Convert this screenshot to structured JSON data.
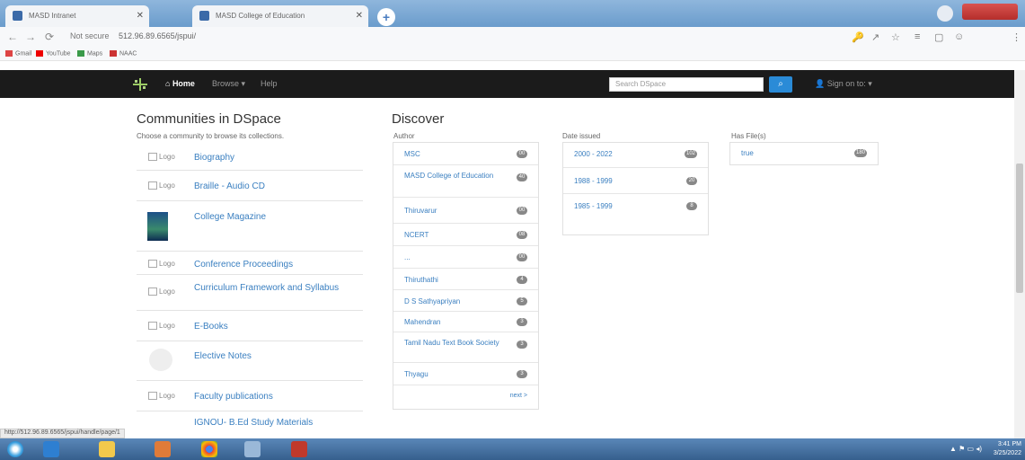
{
  "browser": {
    "tabs": [
      {
        "title": "MASD Intranet"
      },
      {
        "title": "MASD College of Education"
      }
    ],
    "address": {
      "warning": "Not secure",
      "url": "512.96.89.6565/jspui/"
    },
    "bookmarks": [
      "Gmail",
      "YouTube",
      "Maps",
      "NAAC"
    ]
  },
  "site_nav": {
    "home": "Home",
    "browse": "Browse ▾",
    "help": "Help",
    "search_placeholder": "Search DSpace",
    "login": "Sign on to: ▾"
  },
  "communities": {
    "title": "Communities in DSpace",
    "subtitle": "Choose a community to browse its collections.",
    "logo_alt": "Logo",
    "items": [
      {
        "label": "Biography"
      },
      {
        "label": "Braille - Audio CD"
      },
      {
        "label": "College Magazine"
      },
      {
        "label": "Conference Proceedings"
      },
      {
        "label": "Curriculum Framework and Syllabus"
      },
      {
        "label": "E-Books"
      },
      {
        "label": "Elective Notes"
      },
      {
        "label": "Faculty publications"
      },
      {
        "label": "IGNOU- B.Ed Study Materials"
      }
    ]
  },
  "discover": {
    "title": "Discover",
    "author": {
      "label": "Author",
      "items": [
        {
          "name": "MSC",
          "count": "00"
        },
        {
          "name": "MASD College of Education",
          "count": "40"
        },
        {
          "name": "Thiruvarur",
          "count": "00"
        },
        {
          "name": "NCERT",
          "count": "08"
        },
        {
          "name": "...",
          "count": "00"
        },
        {
          "name": "Thiruthathi",
          "count": "4"
        },
        {
          "name": "D S Sathyapriyan",
          "count": "5"
        },
        {
          "name": "Mahendran",
          "count": "3"
        },
        {
          "name": "Tamil Nadu Text Book Society",
          "count": "3"
        },
        {
          "name": "Thyagu",
          "count": "3"
        }
      ],
      "more": "next >"
    },
    "date_issued": {
      "label": "Date issued",
      "items": [
        {
          "name": "2000 - 2022",
          "count": "102"
        },
        {
          "name": "1988 - 1999",
          "count": "20"
        },
        {
          "name": "1985 - 1999",
          "count": "8"
        }
      ]
    },
    "has_files": {
      "label": "Has File(s)",
      "items": [
        {
          "name": "true",
          "count": "180"
        }
      ]
    }
  },
  "status_url": "http://512.96.89.6565/jspui/handle/page/1",
  "taskbar": {
    "time": "3:41 PM",
    "date": "3/25/2022"
  },
  "colors": {
    "link": "#3a7fc0",
    "nav_bg": "#1b1b1b",
    "search_btn": "#2a8bd7",
    "badge": "#888888"
  }
}
